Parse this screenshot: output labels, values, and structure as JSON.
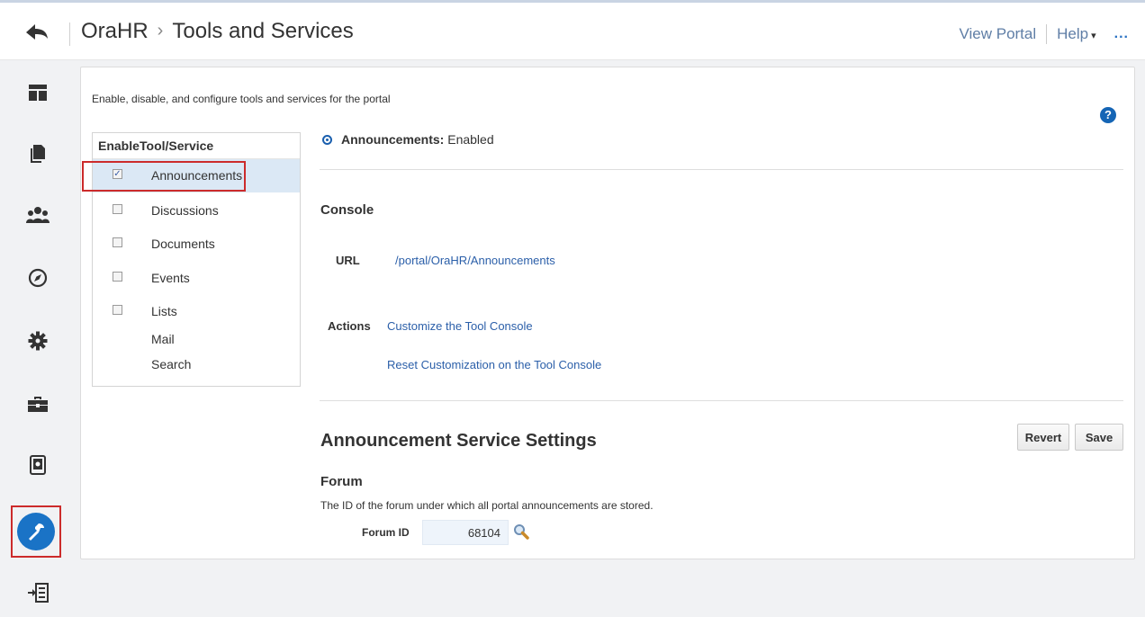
{
  "header": {
    "portal": "OraHR",
    "separator": "›",
    "title": "Tools and Services",
    "view_portal": "View Portal",
    "help": "Help",
    "help_caret": "▾",
    "more": "..."
  },
  "nav": {
    "items": [
      "back-icon",
      "layout-icon",
      "pages-icon",
      "members-icon",
      "compass-icon",
      "settings-gear-icon",
      "toolbox-icon",
      "device-settings-icon",
      "tools-hammer-icon",
      "import-icon"
    ],
    "selected": "tools-hammer-icon",
    "accent": "#1a73c6",
    "highlight": "#cc2b2b"
  },
  "intro": "Enable, disable, and configure tools and services for the portal",
  "help_icon": "?",
  "table": {
    "col_enable": "Enable",
    "col_service": "Tool/Service",
    "rows": [
      {
        "label": "Announcements",
        "checked": true,
        "has_checkbox": true
      },
      {
        "label": "Discussions",
        "checked": false,
        "has_checkbox": true
      },
      {
        "label": "Documents",
        "checked": false,
        "has_checkbox": true
      },
      {
        "label": "Events",
        "checked": false,
        "has_checkbox": true
      },
      {
        "label": "Lists",
        "checked": false,
        "has_checkbox": true
      },
      {
        "label": "Mail",
        "has_checkbox": false
      },
      {
        "label": "Search",
        "has_checkbox": false
      }
    ]
  },
  "detail": {
    "service_name": "Announcements:",
    "status": "Enabled",
    "console_title": "Console",
    "url_label": "URL",
    "url_value": "/portal/OraHR/Announcements",
    "actions_label": "Actions",
    "action_customize": "Customize the Tool Console",
    "action_reset": "Reset Customization on the Tool Console",
    "settings_title": "Announcement Service Settings",
    "revert": "Revert",
    "save": "Save",
    "forum_title": "Forum",
    "forum_desc": "The ID of the forum under which all portal announcements are stored.",
    "forum_id_label": "Forum ID",
    "forum_id_value": "68104"
  },
  "colors": {
    "link": "#2b5fa9",
    "selected_row": "#dbe8f5",
    "help_blue": "#1565b5"
  }
}
